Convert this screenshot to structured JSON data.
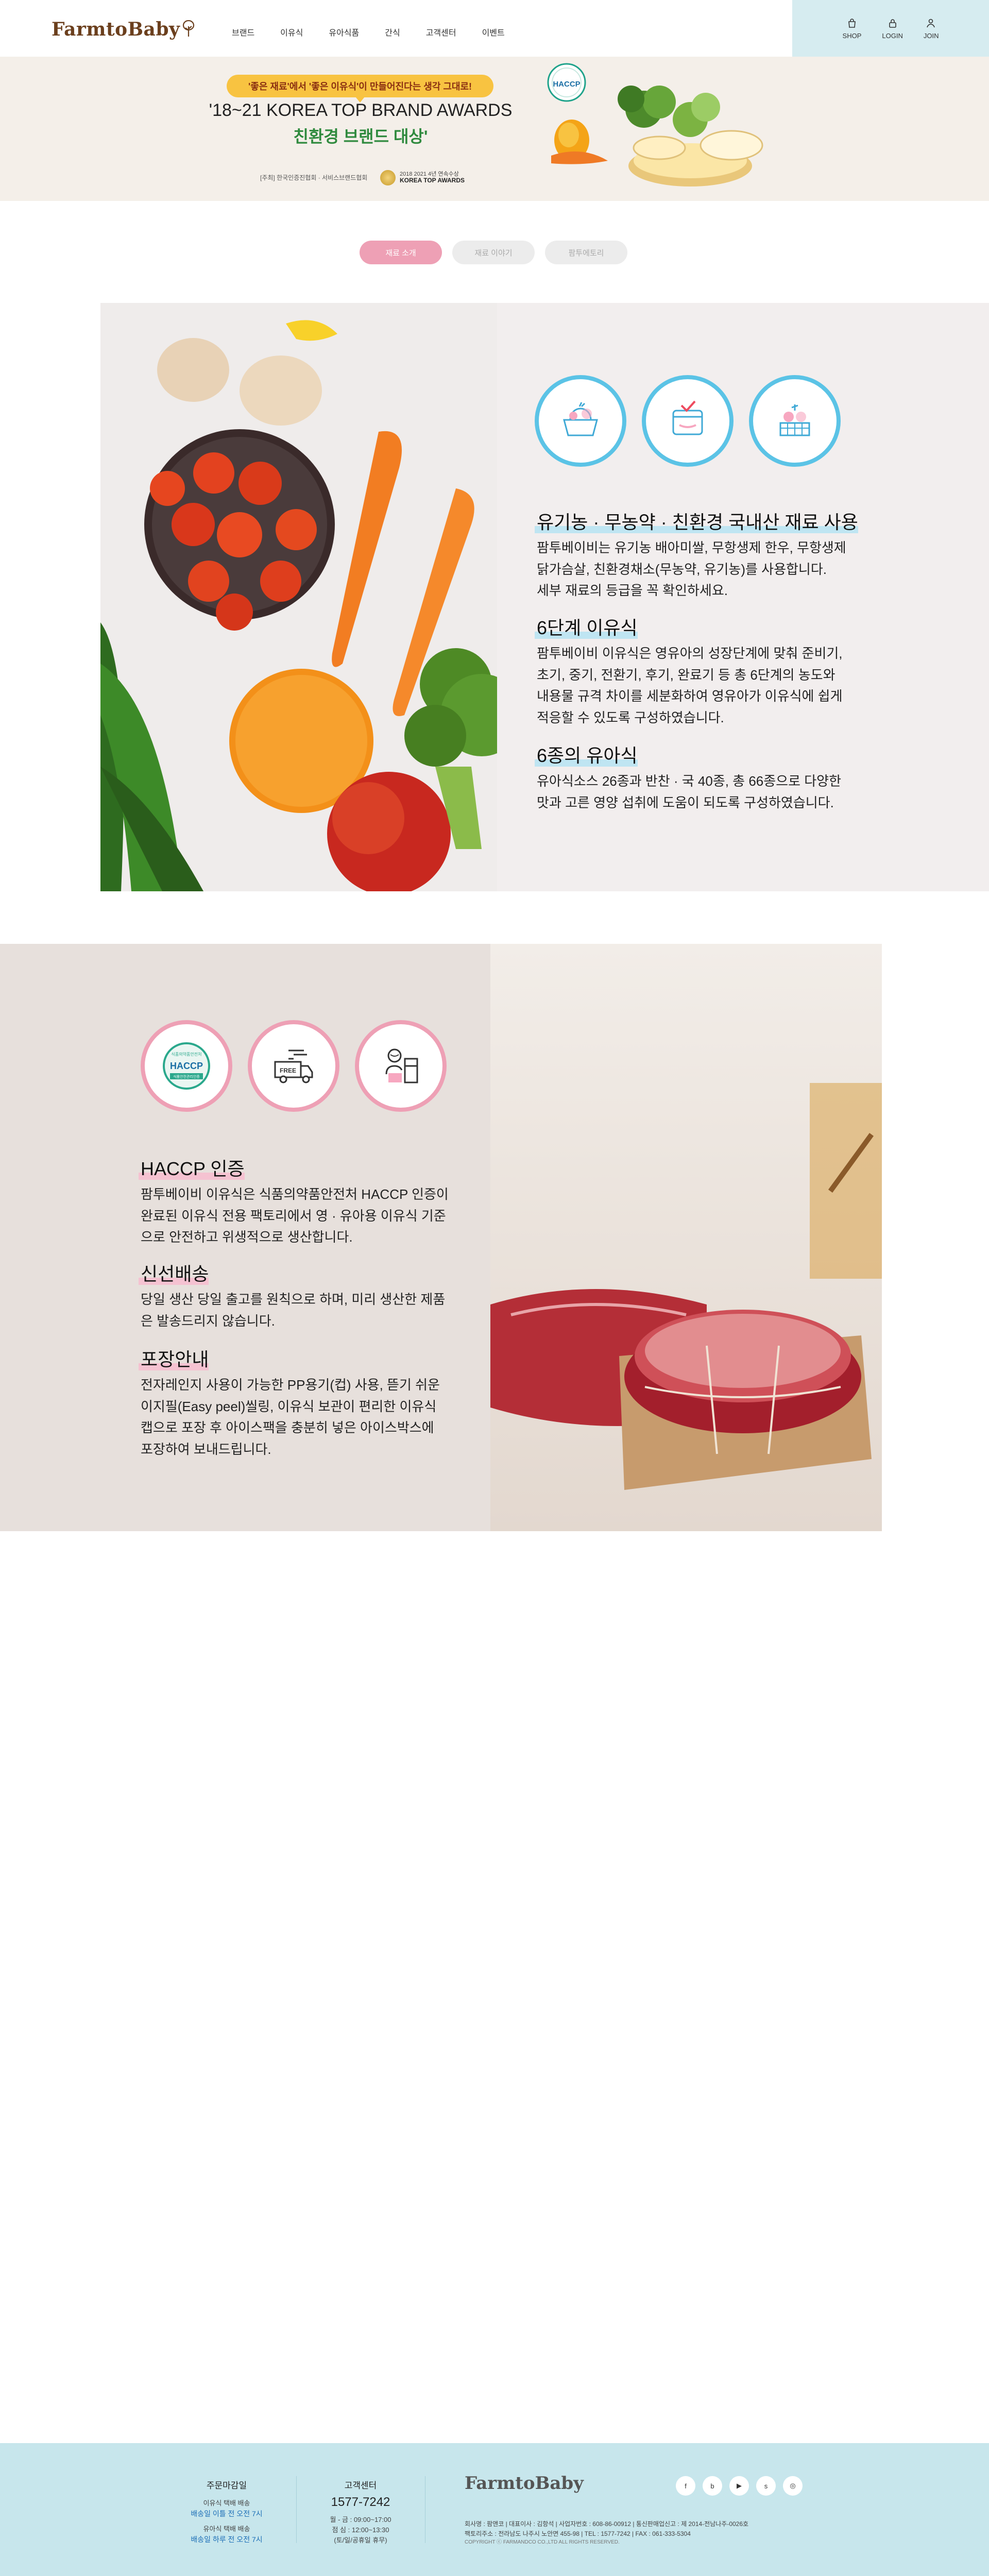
{
  "header": {
    "logo": "FarmtoBaby",
    "nav": [
      "브랜드",
      "이유식",
      "유아식품",
      "간식",
      "고객센터",
      "이벤트"
    ],
    "util": [
      {
        "label": "SHOP",
        "icon": "shopping-bag-icon"
      },
      {
        "label": "LOGIN",
        "icon": "lock-icon"
      },
      {
        "label": "JOIN",
        "icon": "user-add-icon"
      }
    ]
  },
  "banner": {
    "pill": "'좋은 재료'에서 '좋은 이유식'이 만들어진다는 생각 그대로!",
    "title": "'18~21 KOREA TOP BRAND AWARDS",
    "subtitle": "친환경 브랜드 대상'",
    "org": "[주최] 한국인증진협회 · 서비스브랜드협회",
    "award_line1": "2018 2021 4년 연속수상",
    "award_line2": "KOREA TOP AWARDS",
    "haccp_badge": "HACCP"
  },
  "tabs": [
    "재료 소개",
    "재료 이야기",
    "팜투에토리"
  ],
  "section1": {
    "icons": [
      "vegetable-basket-icon",
      "checked-container-icon",
      "vegetable-crate-icon"
    ],
    "features": [
      {
        "title": "유기농 · 무농약 · 친환경 국내산 재료 사용",
        "body": [
          "팜투베이비는 유기농 배아미쌀, 무항생제 한우, 무항생제",
          "닭가슴살, 친환경채소(무농약, 유기농)를 사용합니다.",
          "세부 재료의 등급을 꼭 확인하세요."
        ]
      },
      {
        "title": "6단계 이유식",
        "body": [
          "팜투베이비 이유식은 영유아의 성장단계에 맞춰 준비기,",
          "초기, 중기, 전환기, 후기, 완료기 등 총 6단계의 농도와",
          "내용물 규격 차이를 세분화하여 영유아가 이유식에 쉽게",
          "적응할 수 있도록 구성하였습니다."
        ]
      },
      {
        "title": "6종의 유아식",
        "body": [
          "유아식소스 26종과 반찬 · 국 40종, 총 66종으로 다양한",
          "맛과 고른 영양 섭취에 도움이 되도록 구성하였습니다."
        ]
      }
    ]
  },
  "section2": {
    "badge_top": "식품의약품안전처",
    "badge_main": "HACCP",
    "badge_bottom": "식품안전관리인증",
    "free_label": "FREE",
    "icons": [
      "haccp-badge-icon",
      "free-delivery-truck-icon",
      "chef-packaging-icon"
    ],
    "features": [
      {
        "title": "HACCP 인증",
        "body": [
          "팜투베이비 이유식은 식품의약품안전처 HACCP 인증이",
          "완료된 이유식 전용 팩토리에서 영 · 유아용 이유식 기준",
          "으로 안전하고 위생적으로 생산합니다."
        ]
      },
      {
        "title": "신선배송",
        "body": [
          "당일 생산 당일 출고를 원칙으로 하며, 미리 생산한 제품",
          "은 발송드리지 않습니다."
        ]
      },
      {
        "title": "포장안내",
        "body": [
          "전자레인지 사용이 가능한 PP용기(컵) 사용, 뜯기 쉬운",
          "이지필(Easy peel)씰링, 이유식 보관이 편리한 이유식",
          "캡으로 포장 후 아이스팩을 충분히 넣은 아이스박스에",
          "포장하여 보내드립니다."
        ]
      }
    ]
  },
  "footer": {
    "order_title": "주문마감일",
    "order_lines": [
      {
        "small": "이유식 택배 배송",
        "blue": "배송일 이틀 전 오전 7시"
      },
      {
        "small": "유아식 택배 배송",
        "blue": "배송일 하루 전 오전 7시"
      }
    ],
    "cs_title": "고객센터",
    "cs_phone": "1577-7242",
    "cs_hours": [
      "월 - 금 : 09:00~17:00",
      "점 심 : 12:00~13:30",
      "(토/일/공휴일 휴무)"
    ],
    "logo": "FarmtoBaby",
    "company": [
      "회사명 : 팜앤코 | 대표이사 : 김항석 | 사업자번호 : 608-86-00912 | 통신판매업신고 : 제 2014-전남나주-0026호",
      "팩토리주소 : 전라남도 나주시 노안면 455-98 | TEL : 1577-7242 | FAX : 061-333-5304"
    ],
    "copyright": "COPYRIGHT ⓒ FARMANDCO CO.,LTD ALL RIGHTS RESERVED.",
    "sns": [
      {
        "icon": "facebook-icon",
        "glyph": "f"
      },
      {
        "icon": "blog-icon",
        "glyph": "b"
      },
      {
        "icon": "youtube-icon",
        "glyph": "▶"
      },
      {
        "icon": "kakao-story-icon",
        "glyph": "s"
      },
      {
        "icon": "instagram-icon",
        "glyph": "◎"
      }
    ]
  }
}
